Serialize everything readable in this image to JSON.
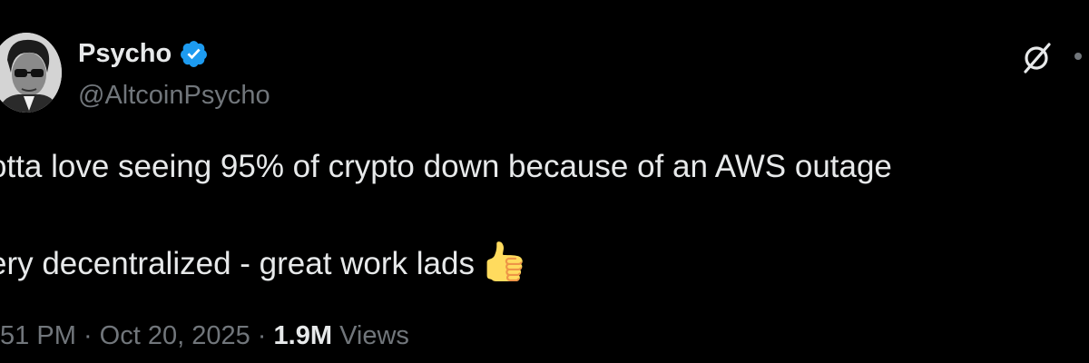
{
  "author": {
    "display_name": "Psycho",
    "handle": "@AltcoinPsycho",
    "verified_badge_icon": "verified-badge-icon",
    "badge_color": "#1d9bf0"
  },
  "header_actions": {
    "grok_icon": "grok-icon",
    "more_icon": "more-icon"
  },
  "tweet": {
    "line1": "otta love seeing 95% of crypto down because of an AWS outage",
    "line2": "ery decentralized - great work lads",
    "emoji_icon": "thumbs-up-icon"
  },
  "meta": {
    "time": ":51 PM",
    "separator": "·",
    "date": "Oct 20, 2025",
    "views_count": "1.9M",
    "views_label": "Views"
  },
  "colors": {
    "background": "#000000",
    "primary_text": "#e7e9ea",
    "secondary_text": "#71767b"
  }
}
